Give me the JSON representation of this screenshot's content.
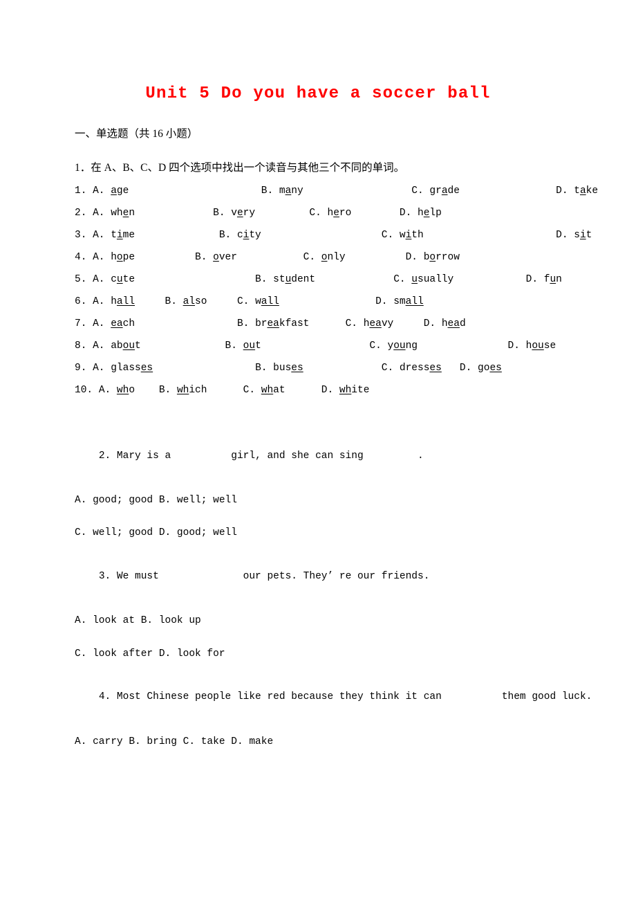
{
  "document": {
    "title": "Unit 5 Do you have a soccer ball",
    "title_color": "#ff0000",
    "section_heading": "一、单选题（共 16 小题）"
  },
  "question1": {
    "stem": "1．在 A、B、C、D 四个选项中找出一个读音与其他三个不同的单词。",
    "rows": [
      {
        "number": "1.",
        "items": [
          {
            "label": "A.",
            "pre": "",
            "mark": "a",
            "post": "ge",
            "gap_after": 22
          },
          {
            "label": "B.",
            "pre": "m",
            "mark": "a",
            "post": "ny",
            "gap_after": 18
          },
          {
            "label": "C.",
            "pre": "gr",
            "mark": "a",
            "post": "de",
            "gap_after": 16
          },
          {
            "label": "D.",
            "pre": "t",
            "mark": "a",
            "post": "ke",
            "gap_after": 0
          }
        ]
      },
      {
        "number": "2.",
        "items": [
          {
            "label": "A.",
            "pre": "wh",
            "mark": "e",
            "post": "n",
            "gap_after": 13
          },
          {
            "label": "B.",
            "pre": "v",
            "mark": "e",
            "post": "ry",
            "gap_after": 9
          },
          {
            "label": "C.",
            "pre": "h",
            "mark": "e",
            "post": "ro",
            "gap_after": 8
          },
          {
            "label": "D.",
            "pre": "h",
            "mark": "e",
            "post": "lp",
            "gap_after": 0
          }
        ]
      },
      {
        "number": "3.",
        "items": [
          {
            "label": "A.",
            "pre": "t",
            "mark": "i",
            "post": "me",
            "gap_after": 14
          },
          {
            "label": "B.",
            "pre": "c",
            "mark": "i",
            "post": "ty",
            "gap_after": 20
          },
          {
            "label": "C.",
            "pre": "w",
            "mark": "i",
            "post": "th",
            "gap_after": 22
          },
          {
            "label": "D.",
            "pre": "s",
            "mark": "i",
            "post": "t",
            "gap_after": 0
          }
        ]
      },
      {
        "number": "4.",
        "items": [
          {
            "label": "A.",
            "pre": "h",
            "mark": "o",
            "post": "pe",
            "gap_after": 10
          },
          {
            "label": "B.",
            "pre": "",
            "mark": "o",
            "post": "ver",
            "gap_after": 11
          },
          {
            "label": "C.",
            "pre": "",
            "mark": "o",
            "post": "nly",
            "gap_after": 10
          },
          {
            "label": "D.",
            "pre": "b",
            "mark": "o",
            "post": "rrow",
            "gap_after": 0
          }
        ]
      },
      {
        "number": "5.",
        "items": [
          {
            "label": "A.",
            "pre": "c",
            "mark": "u",
            "post": "te",
            "gap_after": 20
          },
          {
            "label": "B.",
            "pre": "st",
            "mark": "u",
            "post": "dent",
            "gap_after": 13
          },
          {
            "label": "C.",
            "pre": "",
            "mark": "u",
            "post": "sually",
            "gap_after": 12
          },
          {
            "label": "D.",
            "pre": "f",
            "mark": "u",
            "post": "n",
            "gap_after": 0
          }
        ]
      },
      {
        "number": "6.",
        "items": [
          {
            "label": "A.",
            "pre": "h",
            "mark": "all",
            "post": "",
            "gap_after": 5
          },
          {
            "label": "B.",
            "pre": "",
            "mark": "al",
            "post": "so",
            "gap_after": 5
          },
          {
            "label": "C.",
            "pre": "w",
            "mark": "all",
            "post": "",
            "gap_after": 16
          },
          {
            "label": "D.",
            "pre": "sm",
            "mark": "all",
            "post": "",
            "gap_after": 0
          }
        ]
      },
      {
        "number": "7.",
        "items": [
          {
            "label": "A.",
            "pre": "",
            "mark": "ea",
            "post": "ch",
            "gap_after": 17
          },
          {
            "label": "B.",
            "pre": "br",
            "mark": "ea",
            "post": "kfast",
            "gap_after": 6
          },
          {
            "label": "C.",
            "pre": "h",
            "mark": "ea",
            "post": "vy",
            "gap_after": 5
          },
          {
            "label": "D.",
            "pre": "h",
            "mark": "ea",
            "post": "d",
            "gap_after": 0
          }
        ]
      },
      {
        "number": "8.",
        "items": [
          {
            "label": "A.",
            "pre": "ab",
            "mark": "ou",
            "post": "t",
            "gap_after": 14
          },
          {
            "label": "B.",
            "pre": "",
            "mark": "ou",
            "post": "t",
            "gap_after": 18
          },
          {
            "label": "C.",
            "pre": "y",
            "mark": "ou",
            "post": "ng",
            "gap_after": 15
          },
          {
            "label": "D.",
            "pre": "h",
            "mark": "ou",
            "post": "se",
            "gap_after": 0
          }
        ]
      },
      {
        "number": "9.",
        "items": [
          {
            "label": "A.",
            "pre": "glass",
            "mark": "es",
            "post": "",
            "gap_after": 17
          },
          {
            "label": "B.",
            "pre": "bus",
            "mark": "es",
            "post": "",
            "gap_after": 13
          },
          {
            "label": "C.",
            "pre": "dress",
            "mark": "es",
            "post": "",
            "gap_after": 3
          },
          {
            "label": "D.",
            "pre": "go",
            "mark": "es",
            "post": "",
            "gap_after": 0
          }
        ]
      },
      {
        "number": "10.",
        "items": [
          {
            "label": "A.",
            "pre": "",
            "mark": "wh",
            "post": "o",
            "gap_after": 4
          },
          {
            "label": "B.",
            "pre": "",
            "mark": "wh",
            "post": "ich",
            "gap_after": 6
          },
          {
            "label": "C.",
            "pre": "",
            "mark": "wh",
            "post": "at",
            "gap_after": 6
          },
          {
            "label": "D.",
            "pre": "",
            "mark": "wh",
            "post": "ite",
            "gap_after": 0
          }
        ]
      }
    ]
  },
  "question2": {
    "stem_part1": "2. Mary is a ",
    "blank1": "________",
    "stem_part2": " girl, and she can sing ",
    "blank2": "________",
    "stem_part3": ".",
    "options_line1": "A. good; good B. well; well",
    "options_line2": "C. well; good D. good; well"
  },
  "question3": {
    "stem_part1": "3. We must ",
    "blank1": "____________",
    "stem_part2": " our pets. They’ re our friends.",
    "options_line1": "A. look at B. look up",
    "options_line2": "C. look after D. look for"
  },
  "question4": {
    "stem_part1": "4. Most Chinese people like red because they think it can ",
    "blank1": "________",
    "stem_part2": " them good luck.",
    "options_line1": "A. carry B. bring C. take D. make"
  }
}
